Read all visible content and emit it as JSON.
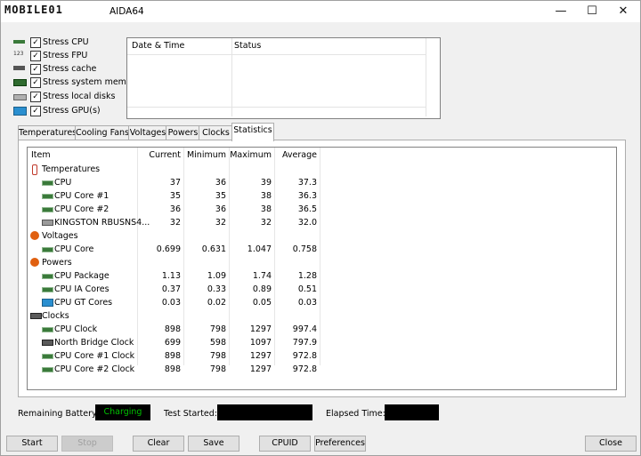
{
  "window": {
    "watermark": "MOBILE01",
    "title": "AIDA64",
    "controls": {
      "minimize": "—",
      "maximize": "☐",
      "close": "✕"
    }
  },
  "stress_options": [
    {
      "label": "Stress CPU",
      "checked": true,
      "icon": "cpu-chip-icon"
    },
    {
      "label": "Stress FPU",
      "checked": true,
      "icon": "fpu-icon"
    },
    {
      "label": "Stress cache",
      "checked": true,
      "icon": "cache-icon"
    },
    {
      "label": "Stress system memory",
      "checked": true,
      "icon": "memory-icon"
    },
    {
      "label": "Stress local disks",
      "checked": true,
      "icon": "disk-icon"
    },
    {
      "label": "Stress GPU(s)",
      "checked": true,
      "icon": "gpu-icon"
    }
  ],
  "log": {
    "col_datetime": "Date & Time",
    "col_status": "Status"
  },
  "tabs": [
    "Temperatures",
    "Cooling Fans",
    "Voltages",
    "Powers",
    "Clocks",
    "Statistics"
  ],
  "active_tab": "Statistics",
  "stats": {
    "headers": {
      "item": "Item",
      "current": "Current",
      "minimum": "Minimum",
      "maximum": "Maximum",
      "average": "Average"
    },
    "rows": [
      {
        "group": true,
        "item": "Temperatures",
        "icon": "thermometer-icon"
      },
      {
        "item": "CPU",
        "current": "37",
        "minimum": "36",
        "maximum": "39",
        "average": "37.3",
        "icon": "cpu-chip-icon"
      },
      {
        "item": "CPU Core #1",
        "current": "35",
        "minimum": "35",
        "maximum": "38",
        "average": "36.3",
        "icon": "cpu-chip-icon"
      },
      {
        "item": "CPU Core #2",
        "current": "36",
        "minimum": "36",
        "maximum": "38",
        "average": "36.5",
        "icon": "cpu-chip-icon"
      },
      {
        "item": "KINGSTON RBUSNS4...",
        "current": "32",
        "minimum": "32",
        "maximum": "32",
        "average": "32.0",
        "icon": "disk-icon"
      },
      {
        "group": true,
        "item": "Voltages",
        "icon": "bolt-icon"
      },
      {
        "item": "CPU Core",
        "current": "0.699",
        "minimum": "0.631",
        "maximum": "1.047",
        "average": "0.758",
        "icon": "cpu-chip-icon"
      },
      {
        "group": true,
        "item": "Powers",
        "icon": "bolt-icon"
      },
      {
        "item": "CPU Package",
        "current": "1.13",
        "minimum": "1.09",
        "maximum": "1.74",
        "average": "1.28",
        "icon": "cpu-chip-icon"
      },
      {
        "item": "CPU IA Cores",
        "current": "0.37",
        "minimum": "0.33",
        "maximum": "0.89",
        "average": "0.51",
        "icon": "cpu-chip-icon"
      },
      {
        "item": "CPU GT Cores",
        "current": "0.03",
        "minimum": "0.02",
        "maximum": "0.05",
        "average": "0.03",
        "icon": "gpu-icon"
      },
      {
        "group": true,
        "item": "Clocks",
        "icon": "clock-board-icon"
      },
      {
        "item": "CPU Clock",
        "current": "898",
        "minimum": "798",
        "maximum": "1297",
        "average": "997.4",
        "icon": "cpu-chip-icon"
      },
      {
        "item": "North Bridge Clock",
        "current": "699",
        "minimum": "598",
        "maximum": "1097",
        "average": "797.9",
        "icon": "motherboard-icon"
      },
      {
        "item": "CPU Core #1 Clock",
        "current": "898",
        "minimum": "798",
        "maximum": "1297",
        "average": "972.8",
        "icon": "cpu-chip-icon"
      },
      {
        "item": "CPU Core #2 Clock",
        "current": "898",
        "minimum": "798",
        "maximum": "1297",
        "average": "972.8",
        "icon": "cpu-chip-icon"
      }
    ]
  },
  "status_bar": {
    "battery_label": "Remaining Battery:",
    "battery_value": "Charging",
    "test_started_label": "Test Started:",
    "test_started_value": "",
    "elapsed_label": "Elapsed Time:",
    "elapsed_value": ""
  },
  "buttons": {
    "start": "Start",
    "stop": "Stop",
    "clear": "Clear",
    "save": "Save",
    "cpuid": "CPUID",
    "preferences": "Preferences",
    "close": "Close"
  },
  "colors": {
    "charging_text": "#00c000",
    "status_box_bg": "#000000"
  }
}
